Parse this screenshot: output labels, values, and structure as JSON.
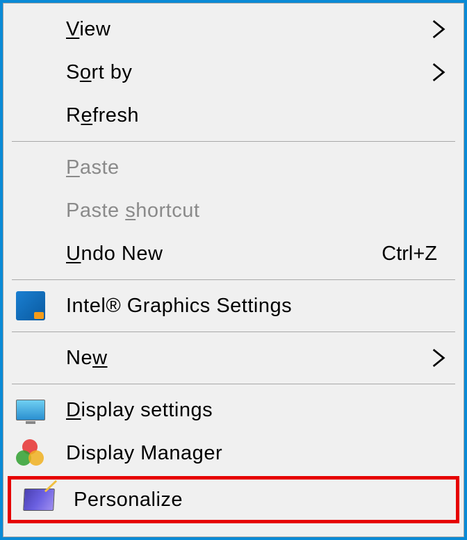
{
  "menu": {
    "view": {
      "pre": "",
      "u": "V",
      "post": "iew",
      "submenu": true
    },
    "sortby": {
      "pre": "S",
      "u": "o",
      "post": "rt by",
      "submenu": true
    },
    "refresh": {
      "pre": "R",
      "u": "e",
      "post": "fresh"
    },
    "paste": {
      "pre": "",
      "u": "P",
      "post": "aste"
    },
    "paste_shortcut": {
      "pre": "Paste ",
      "u": "s",
      "post": "hortcut"
    },
    "undo_new": {
      "pre": "",
      "u": "U",
      "post": "ndo New",
      "shortcut": "Ctrl+Z"
    },
    "intel_graphics": {
      "label": "Intel® Graphics Settings"
    },
    "new": {
      "pre": "Ne",
      "u": "w",
      "post": "",
      "submenu": true
    },
    "display_settings": {
      "pre": "",
      "u": "D",
      "post": "isplay settings"
    },
    "display_manager": {
      "label": "Display Manager"
    },
    "personalize": {
      "label": "Personalize"
    }
  }
}
